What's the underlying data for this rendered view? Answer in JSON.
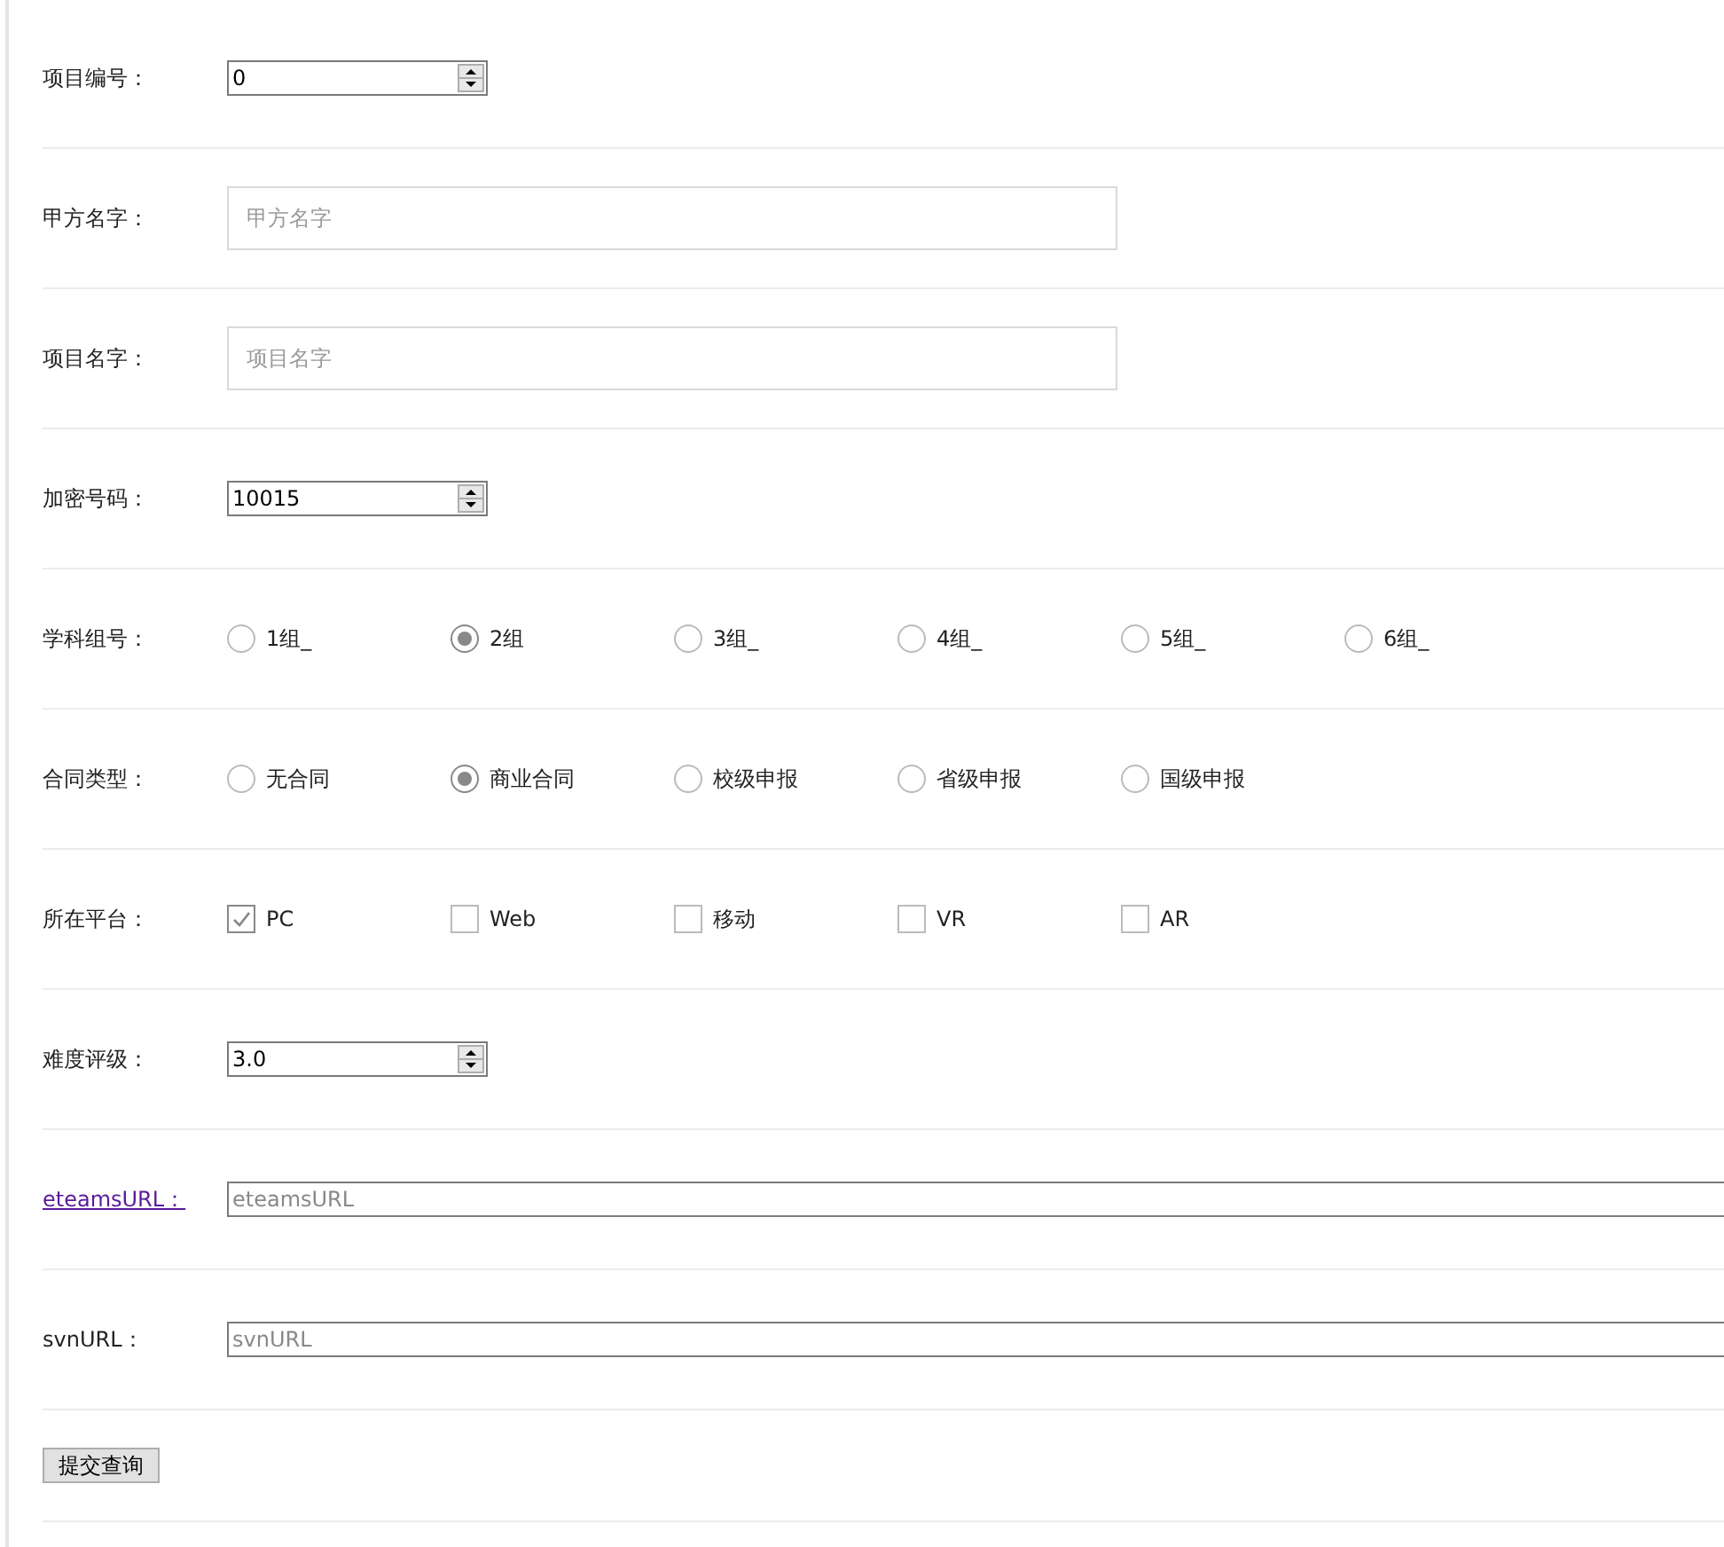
{
  "fields": [
    {
      "kind": "number",
      "label": "项目编号：",
      "value": "0"
    },
    {
      "kind": "text",
      "label": "甲方名字：",
      "placeholder": "甲方名字"
    },
    {
      "kind": "text",
      "label": "项目名字：",
      "placeholder": "项目名字"
    },
    {
      "kind": "number",
      "label": "加密号码：",
      "value": "10015"
    },
    {
      "kind": "radio",
      "label": "学科组号：",
      "options": [
        {
          "label": "1组_",
          "selected": false
        },
        {
          "label": "2组",
          "selected": true
        },
        {
          "label": "3组_",
          "selected": false
        },
        {
          "label": "4组_",
          "selected": false
        },
        {
          "label": "5组_",
          "selected": false
        },
        {
          "label": "6组_",
          "selected": false
        }
      ]
    },
    {
      "kind": "radio",
      "label": "合同类型：",
      "options": [
        {
          "label": "无合同",
          "selected": false
        },
        {
          "label": "商业合同",
          "selected": true
        },
        {
          "label": "校级申报",
          "selected": false
        },
        {
          "label": "省级申报",
          "selected": false
        },
        {
          "label": "国级申报",
          "selected": false
        }
      ]
    },
    {
      "kind": "checkbox",
      "label": "所在平台：",
      "options": [
        {
          "label": "PC",
          "checked": true
        },
        {
          "label": "Web",
          "checked": false
        },
        {
          "label": "移动",
          "checked": false
        },
        {
          "label": "VR",
          "checked": false
        },
        {
          "label": "AR",
          "checked": false
        }
      ]
    },
    {
      "kind": "number",
      "label": "难度评级：",
      "value": "3.0"
    },
    {
      "kind": "url",
      "label": "eteamsURL：",
      "link": true,
      "placeholder": "eteamsURL"
    },
    {
      "kind": "url",
      "label": "svnURL：",
      "link": false,
      "placeholder": "svnURL"
    }
  ],
  "submit": "提交查询"
}
